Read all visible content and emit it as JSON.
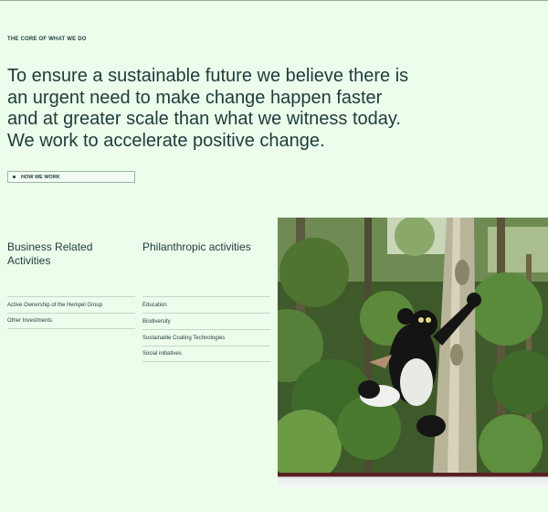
{
  "section": {
    "eyebrow": "THE CORE OF WHAT WE DO",
    "headline": "To ensure a sustainable future we believe there is an urgent need to make change happen faster and at greater scale than what we witness today. We work to accelerate positive change.",
    "cta_label": "HOW WE WORK"
  },
  "columns": [
    {
      "title": "Business Related Activities",
      "items": [
        "Active Ownership of the Hempel Group",
        "Other Investments"
      ]
    },
    {
      "title": "Philanthropic activities",
      "items": [
        "Education",
        "Biodiversity",
        "Sustainable Coating Technologies",
        "Social initiatives"
      ]
    }
  ],
  "image": {
    "subject": "indri-lemur-photo"
  },
  "colors": {
    "background": "#ecfdec",
    "text": "#1f3b3a",
    "divider": "#c7d6c9"
  }
}
